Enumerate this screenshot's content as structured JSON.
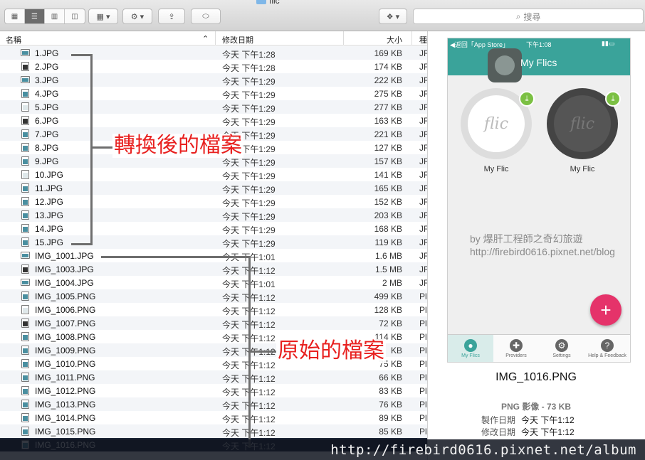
{
  "window": {
    "title": "flic"
  },
  "toolbar": {
    "view_icons": [
      "grid-view-icon",
      "list-view-icon",
      "column-view-icon",
      "coverflow-view-icon"
    ],
    "search_placeholder": "搜尋"
  },
  "columns": {
    "name": "名稱",
    "date": "修改日期",
    "size": "大小",
    "kind": "種"
  },
  "files": [
    {
      "name": "1.JPG",
      "date": "今天 下午1:28",
      "size": "169 KB",
      "kind": "JF"
    },
    {
      "name": "2.JPG",
      "date": "今天 下午1:28",
      "size": "174 KB",
      "kind": "JF"
    },
    {
      "name": "3.JPG",
      "date": "今天 下午1:29",
      "size": "222 KB",
      "kind": "JF"
    },
    {
      "name": "4.JPG",
      "date": "今天 下午1:29",
      "size": "275 KB",
      "kind": "JF"
    },
    {
      "name": "5.JPG",
      "date": "今天 下午1:29",
      "size": "277 KB",
      "kind": "JF"
    },
    {
      "name": "6.JPG",
      "date": "今天 下午1:29",
      "size": "163 KB",
      "kind": "JF"
    },
    {
      "name": "7.JPG",
      "date": "今天 下午1:29",
      "size": "221 KB",
      "kind": "JF"
    },
    {
      "name": "8.JPG",
      "date": "今天 下午1:29",
      "size": "127 KB",
      "kind": "JF"
    },
    {
      "name": "9.JPG",
      "date": "今天 下午1:29",
      "size": "157 KB",
      "kind": "JF"
    },
    {
      "name": "10.JPG",
      "date": "今天 下午1:29",
      "size": "141 KB",
      "kind": "JF"
    },
    {
      "name": "11.JPG",
      "date": "今天 下午1:29",
      "size": "165 KB",
      "kind": "JF"
    },
    {
      "name": "12.JPG",
      "date": "今天 下午1:29",
      "size": "152 KB",
      "kind": "JF"
    },
    {
      "name": "13.JPG",
      "date": "今天 下午1:29",
      "size": "203 KB",
      "kind": "JF"
    },
    {
      "name": "14.JPG",
      "date": "今天 下午1:29",
      "size": "168 KB",
      "kind": "JF"
    },
    {
      "name": "15.JPG",
      "date": "今天 下午1:29",
      "size": "119 KB",
      "kind": "JF"
    },
    {
      "name": "IMG_1001.JPG",
      "date": "今天 下午1:01",
      "size": "1.6 MB",
      "kind": "JF"
    },
    {
      "name": "IMG_1003.JPG",
      "date": "今天 下午1:12",
      "size": "1.5 MB",
      "kind": "JF"
    },
    {
      "name": "IMG_1004.JPG",
      "date": "今天 下午1:01",
      "size": "2 MB",
      "kind": "JF"
    },
    {
      "name": "IMG_1005.PNG",
      "date": "今天 下午1:12",
      "size": "499 KB",
      "kind": "Pl"
    },
    {
      "name": "IMG_1006.PNG",
      "date": "今天 下午1:12",
      "size": "128 KB",
      "kind": "Pl"
    },
    {
      "name": "IMG_1007.PNG",
      "date": "今天 下午1:12",
      "size": "72 KB",
      "kind": "Pl"
    },
    {
      "name": "IMG_1008.PNG",
      "date": "今天 下午1:12",
      "size": "114 KB",
      "kind": "Pl"
    },
    {
      "name": "IMG_1009.PNG",
      "date": "今天 下午1:12",
      "size": "KB",
      "kind": "Pl"
    },
    {
      "name": "IMG_1010.PNG",
      "date": "今天 下午1:12",
      "size": "75 KB",
      "kind": "Pl"
    },
    {
      "name": "IMG_1011.PNG",
      "date": "今天 下午1:12",
      "size": "66 KB",
      "kind": "Pl"
    },
    {
      "name": "IMG_1012.PNG",
      "date": "今天 下午1:12",
      "size": "83 KB",
      "kind": "Pl"
    },
    {
      "name": "IMG_1013.PNG",
      "date": "今天 下午1:12",
      "size": "76 KB",
      "kind": "Pl"
    },
    {
      "name": "IMG_1014.PNG",
      "date": "今天 下午1:12",
      "size": "89 KB",
      "kind": "Pl"
    },
    {
      "name": "IMG_1015.PNG",
      "date": "今天 下午1:12",
      "size": "85 KB",
      "kind": "Pl"
    },
    {
      "name": "IMG_1016.PNG",
      "date": "今天 下午1:12",
      "size": "",
      "kind": ""
    }
  ],
  "annotations": {
    "converted": "轉換後的檔案",
    "original": "原始的檔案"
  },
  "preview": {
    "phone": {
      "status_left": "◀返回「App Store」",
      "status_time": "下午1:08",
      "title": "My Flics",
      "flic1_label": "My Flic",
      "flic2_label": "My Flic",
      "flic_logo": "flic",
      "fab": "+",
      "tabs": [
        "My Flics",
        "Providers",
        "Settings",
        "Help & Feedback"
      ]
    },
    "watermark_line1": "by 爆肝工程師之奇幻旅遊",
    "watermark_line2": "http://firebird0616.pixnet.net/blog",
    "filename": "IMG_1016.PNG",
    "type_size": "PNG 影像 - 73 KB",
    "meta": [
      {
        "key": "製作日期",
        "value": "今天 下午1:12"
      },
      {
        "key": "修改日期",
        "value": "今天 下午1:12"
      }
    ]
  },
  "footer": {
    "watermark": "http://firebird0616.pixnet.net/album"
  }
}
